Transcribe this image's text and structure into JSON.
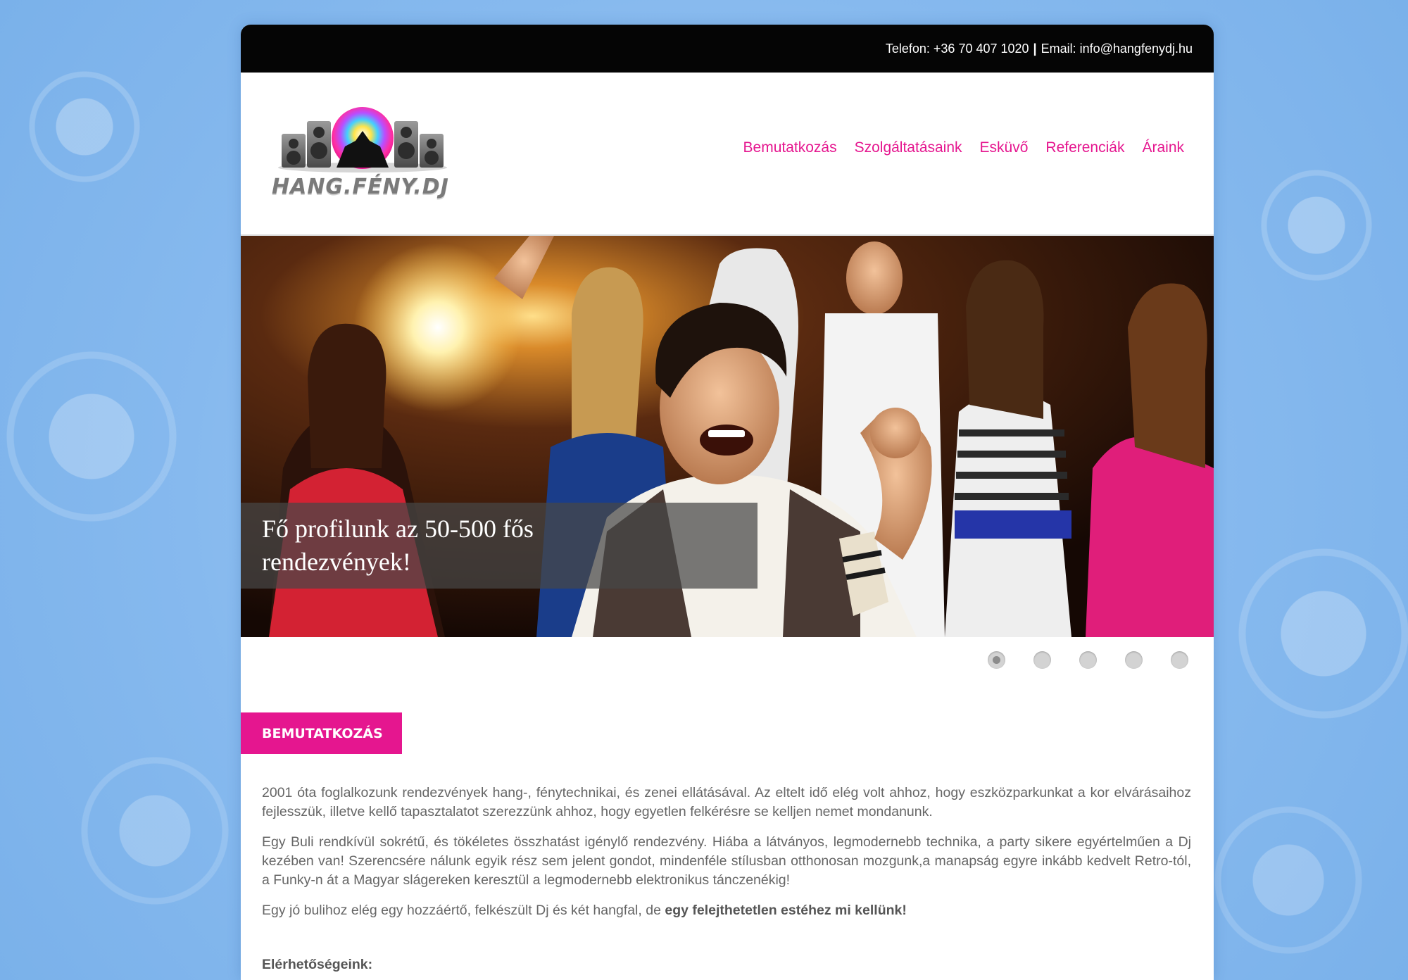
{
  "topbar": {
    "phone": "Telefon: +36 70 407 1020",
    "separator": "|",
    "email": "Email: info@hangfenydj.hu"
  },
  "logo": {
    "text": "HANG.FÉNY.DJ"
  },
  "nav": {
    "items": [
      {
        "label": "Bemutatkozás"
      },
      {
        "label": "Szolgáltatásaink"
      },
      {
        "label": "Esküvő"
      },
      {
        "label": "Referenciák"
      },
      {
        "label": "Áraink"
      }
    ]
  },
  "hero": {
    "caption_line1": "Fő profilunk az 50-500 fős",
    "caption_line2": "rendezvények!",
    "slide_count": 5,
    "active_slide": 1
  },
  "section": {
    "title": "BEMUTATKOZÁS"
  },
  "content": {
    "p1": "2001 óta foglalkozunk rendezvények hang-, fénytechnikai, és zenei ellátásával. Az eltelt idő elég volt ahhoz, hogy eszközparkunkat a kor elvárásaihoz fejlesszük, illetve kellő tapasztalatot szerezzünk ahhoz, hogy egyetlen felkérésre se kelljen nemet mondanunk.",
    "p2": "Egy Buli rendkívül sokrétű, és tökéletes összhatást igénylő rendezvény. Hiába a látványos, legmodernebb technika, a party sikere egyértelműen a Dj kezében van! Szerencsére nálunk egyik rész sem jelent gondot, mindenféle stílusban otthonosan mozgunk,a manapság egyre inkább kedvelt Retro-tól, a Funky-n át a Magyar slágereken keresztül a legmodernebb elektronikus tánczenékig!",
    "p3_start": "Egy jó bulihoz elég egy hozzáértő, felkészült Dj és két hangfal, de ",
    "p3_bold": "egy felejthetetlen estéhez mi kellünk!",
    "contacts_heading": "Elérhetőségeink:"
  },
  "colors": {
    "accent": "#e5168f",
    "topbar": "#050505",
    "background": "#8cbdf0"
  },
  "icons": [
    "speaker-logo-icon",
    "slider-dot-icon"
  ]
}
